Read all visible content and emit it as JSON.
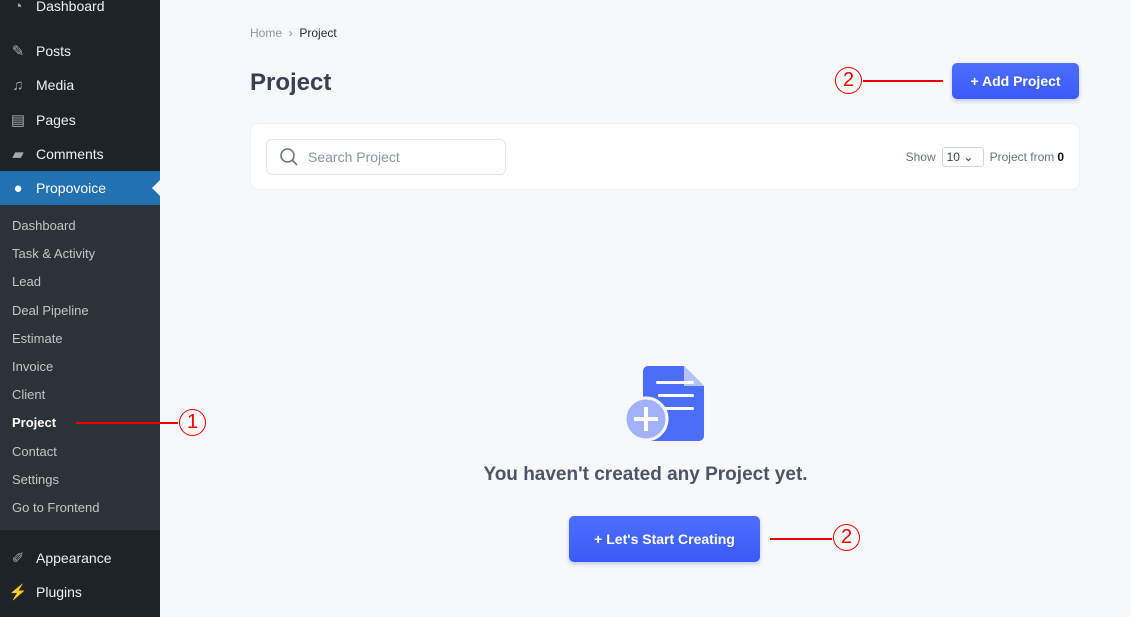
{
  "sidebar": {
    "items": [
      {
        "label": "Dashboard",
        "icon": "dashboard-icon"
      },
      {
        "label": "Posts",
        "icon": "pin-icon"
      },
      {
        "label": "Media",
        "icon": "media-icon"
      },
      {
        "label": "Pages",
        "icon": "pages-icon"
      },
      {
        "label": "Comments",
        "icon": "comment-icon"
      },
      {
        "label": "Propovoice",
        "icon": "users-icon"
      },
      {
        "label": "Appearance",
        "icon": "brush-icon"
      },
      {
        "label": "Plugins",
        "icon": "plug-icon"
      }
    ],
    "submenu": [
      "Dashboard",
      "Task & Activity",
      "Lead",
      "Deal Pipeline",
      "Estimate",
      "Invoice",
      "Client",
      "Project",
      "Contact",
      "Settings",
      "Go to Frontend"
    ]
  },
  "breadcrumb": {
    "home": "Home",
    "current": "Project"
  },
  "page_title": "Project",
  "add_button": "+ Add Project",
  "search": {
    "placeholder": "Search Project"
  },
  "pager": {
    "show": "Show",
    "value": "10",
    "from": "Project from",
    "count": "0"
  },
  "empty": {
    "message": "You haven't created any Project yet.",
    "button": "+ Let's Start Creating"
  },
  "annotations": [
    "1",
    "2",
    "2"
  ],
  "colors": {
    "accent": "#3f60f8",
    "sidebar": "#1d2327",
    "active": "#2271b1",
    "annotation": "#ee0000"
  }
}
